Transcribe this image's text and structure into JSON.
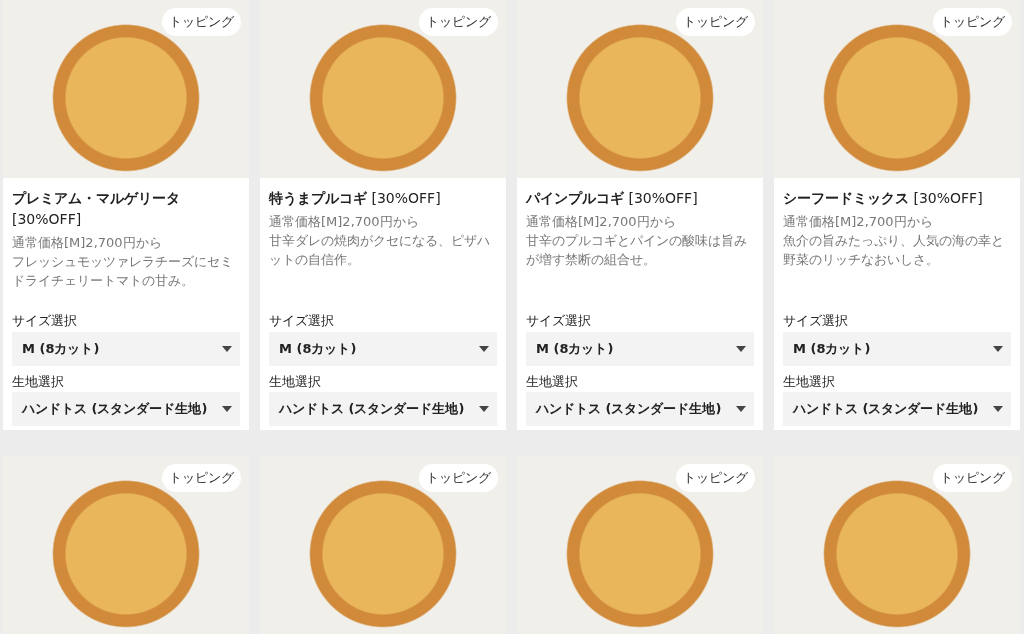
{
  "menu_items": [
    {
      "topping_label": "トッピング",
      "title": "**プレミアム・マルゲリータ**\n[30%OFF]",
      "price": "通常価格[M]2,700円から",
      "description": "フレッシュモッツァレラチーズにセミドライチェリートマトの甘み。",
      "size_label": "サイズ選択",
      "size_value": "M (8カット)",
      "crust_label": "生地選択",
      "crust_value": "ハンドトス (スタンダード生地)"
    },
    {
      "topping_label": "トッピング",
      "title": "**特うまプルコギ** [30%OFF]",
      "price": "通常価格[M]2,700円から",
      "description": "甘辛ダレの焼肉がクセになる、ピザハットの自信作。",
      "size_label": "サイズ選択",
      "size_value": "M (8カット)",
      "crust_label": "生地選択",
      "crust_value": "ハンドトス (スタンダード生地)"
    },
    {
      "topping_label": "トッピング",
      "title": "**パインプルコギ** [30%OFF]",
      "price": "通常価格[M]2,700円から",
      "description": "甘辛のプルコギとパインの酸味は旨みが増す禁断の組合せ。",
      "size_label": "サイズ選択",
      "size_value": "M (8カット)",
      "crust_label": "生地選択",
      "crust_value": "ハンドトス (スタンダード生地)"
    },
    {
      "topping_label": "トッピング",
      "title": "**シーフードミックス** [30%OFF]",
      "price": "通常価格[M]2,700円から",
      "description": "魚介の旨みたっぷり、人気の海の幸と野菜のリッチなおいしさ。",
      "size_label": "サイズ選択",
      "size_value": "M (8カット)",
      "crust_label": "生地選択",
      "crust_value": "ハンドトス (スタンダード生地)"
    },
    {
      "topping_label": "トッピング"
    },
    {
      "topping_label": "トッピング"
    },
    {
      "topping_label": "トッピング"
    },
    {
      "topping_label": "トッピング"
    }
  ]
}
